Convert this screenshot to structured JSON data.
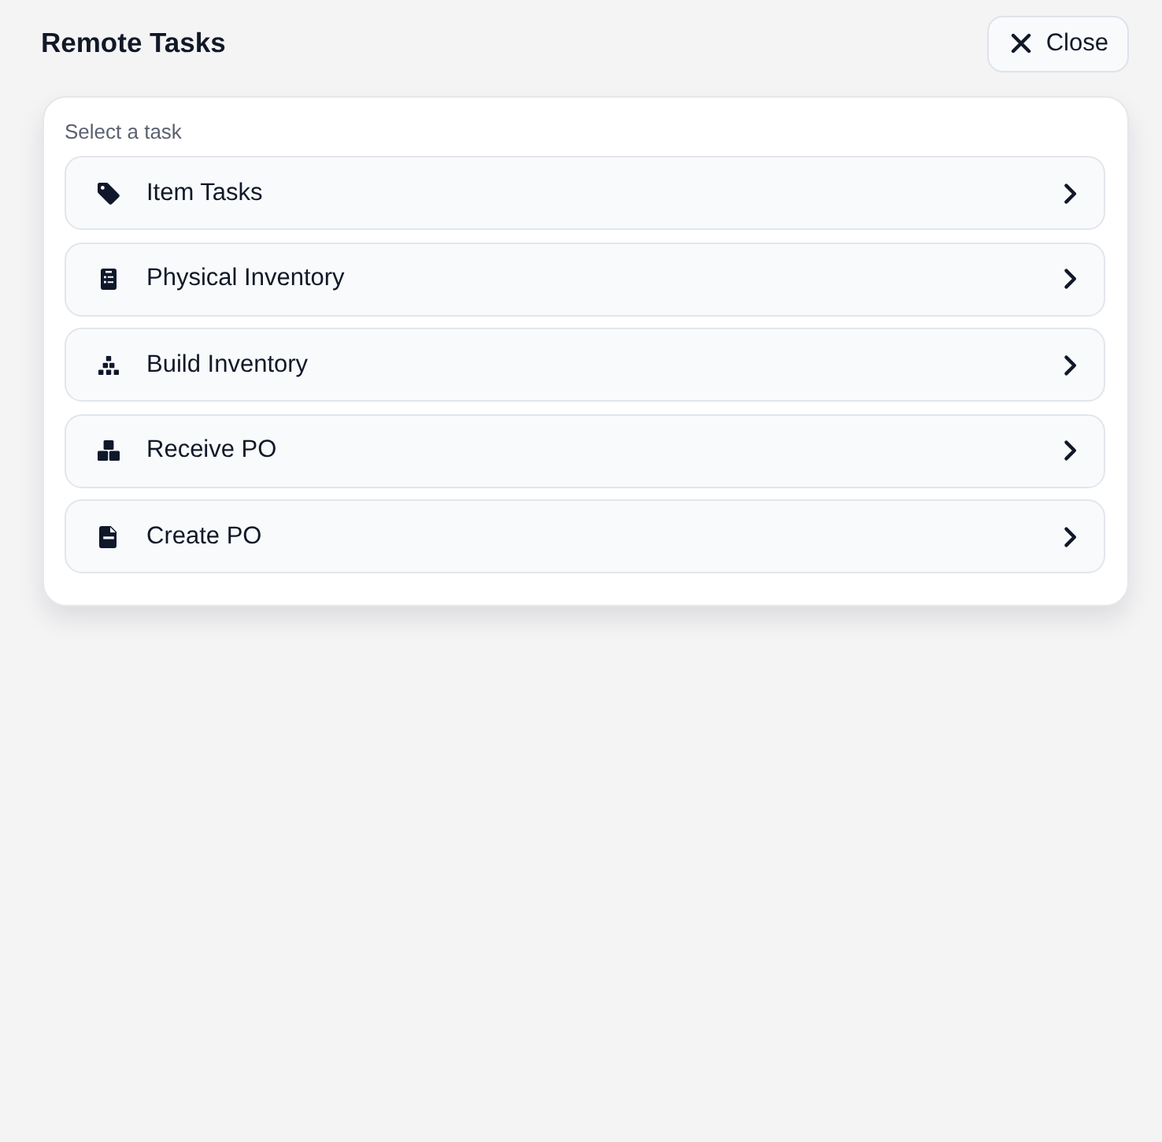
{
  "header": {
    "title": "Remote Tasks",
    "close_button": {
      "label": "Close"
    }
  },
  "task_panel": {
    "label": "Select a task",
    "tasks": [
      {
        "label": "Item Tasks"
      },
      {
        "label": "Physical Inventory"
      },
      {
        "label": "Build Inventory"
      },
      {
        "label": "Receive PO"
      },
      {
        "label": "Create PO"
      }
    ]
  }
}
